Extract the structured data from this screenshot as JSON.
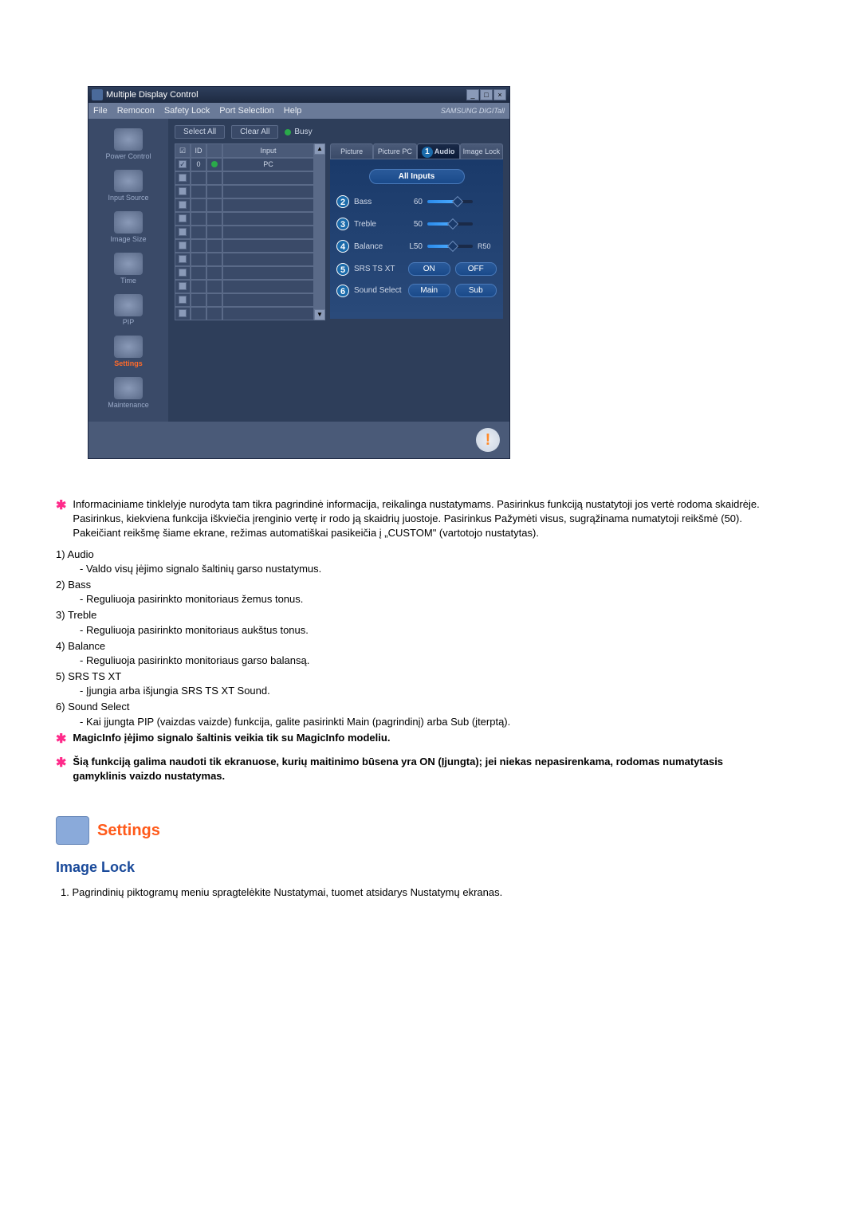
{
  "window": {
    "title": "Multiple Display Control",
    "win_min": "_",
    "win_max": "□",
    "win_close": "×"
  },
  "menu": {
    "file": "File",
    "remocon": "Remocon",
    "safety_lock": "Safety Lock",
    "port_selection": "Port Selection",
    "help": "Help",
    "brand": "SAMSUNG DIGITall"
  },
  "sidebar": {
    "items": [
      {
        "label": "Power Control"
      },
      {
        "label": "Input Source"
      },
      {
        "label": "Image Size"
      },
      {
        "label": "Time"
      },
      {
        "label": "PIP"
      },
      {
        "label": "Settings"
      },
      {
        "label": "Maintenance"
      }
    ]
  },
  "toolbar": {
    "select_all": "Select All",
    "clear_all": "Clear All",
    "busy": "Busy"
  },
  "table": {
    "headers": {
      "id": "ID",
      "input": "Input"
    },
    "rows": [
      {
        "checked": true,
        "id": "0",
        "status": "green",
        "input": "PC"
      },
      {
        "checked": false,
        "id": "",
        "status": "",
        "input": ""
      },
      {
        "checked": false,
        "id": "",
        "status": "",
        "input": ""
      },
      {
        "checked": false,
        "id": "",
        "status": "",
        "input": ""
      },
      {
        "checked": false,
        "id": "",
        "status": "",
        "input": ""
      },
      {
        "checked": false,
        "id": "",
        "status": "",
        "input": ""
      },
      {
        "checked": false,
        "id": "",
        "status": "",
        "input": ""
      },
      {
        "checked": false,
        "id": "",
        "status": "",
        "input": ""
      },
      {
        "checked": false,
        "id": "",
        "status": "",
        "input": ""
      },
      {
        "checked": false,
        "id": "",
        "status": "",
        "input": ""
      },
      {
        "checked": false,
        "id": "",
        "status": "",
        "input": ""
      },
      {
        "checked": false,
        "id": "",
        "status": "",
        "input": ""
      }
    ]
  },
  "tabs": {
    "picture": "Picture",
    "picture_pc": "Picture PC",
    "audio": "Audio",
    "audio_num": "1",
    "image_lock": "Image Lock"
  },
  "audio_panel": {
    "all_inputs": "All Inputs",
    "bass": {
      "num": "2",
      "label": "Bass",
      "value": "60"
    },
    "treble": {
      "num": "3",
      "label": "Treble",
      "value": "50"
    },
    "balance": {
      "num": "4",
      "label": "Balance",
      "value_l": "L50",
      "value_r": "R50"
    },
    "srs": {
      "num": "5",
      "label": "SRS TS XT",
      "on": "ON",
      "off": "OFF"
    },
    "sound_select": {
      "num": "6",
      "label": "Sound Select",
      "main": "Main",
      "sub": "Sub"
    }
  },
  "info_glyph": "!",
  "doc": {
    "intro": "Informaciniame tinklelyje nurodyta tam tikra pagrindinė informacija, reikalinga nustatymams. Pasirinkus funkciją nustatytoji jos vertė rodoma skaidrėje. Pasirinkus, kiekviena funkcija iškviečia įrenginio vertę ir rodo ją skaidrių juostoje. Pasirinkus Pažymėti visus, sugrąžinama numatytoji reikšmė (50). Pakeičiant reikšmę šiame ekrane, režimas automatiškai pasikeičia į „CUSTOM\" (vartotojo nustatytas).",
    "items": [
      {
        "num": "1)",
        "title": "Audio",
        "desc": "Valdo visų įėjimo signalo šaltinių garso nustatymus."
      },
      {
        "num": "2)",
        "title": "Bass",
        "desc": "Reguliuoja pasirinkto monitoriaus žemus tonus."
      },
      {
        "num": "3)",
        "title": "Treble",
        "desc": "Reguliuoja pasirinkto monitoriaus aukštus tonus."
      },
      {
        "num": "4)",
        "title": "Balance",
        "desc": "Reguliuoja pasirinkto monitoriaus garso balansą."
      },
      {
        "num": "5)",
        "title": "SRS TS XT",
        "desc": "Įjungia arba išjungia SRS TS XT Sound."
      },
      {
        "num": "6)",
        "title": "Sound Select",
        "desc": "Kai įjungta PIP (vaizdas vaizde) funkcija, galite pasirinkti Main (pagrindinį) arba Sub (įterptą)."
      }
    ],
    "note1": "MagicInfo įėjimo signalo šaltinis veikia tik su MagicInfo modeliu.",
    "note2": "Šią funkciją galima naudoti tik ekranuose, kurių maitinimo būsena yra ON (Įjungta); jei niekas nepasirenkama, rodomas numatytasis gamyklinis vaizdo nustatymas.",
    "section_title": "Settings",
    "subsection": "Image Lock",
    "step1_num": "1.",
    "step1": "Pagrindinių piktogramų meniu spragtelėkite Nustatymai, tuomet atsidarys Nustatymų ekranas."
  }
}
